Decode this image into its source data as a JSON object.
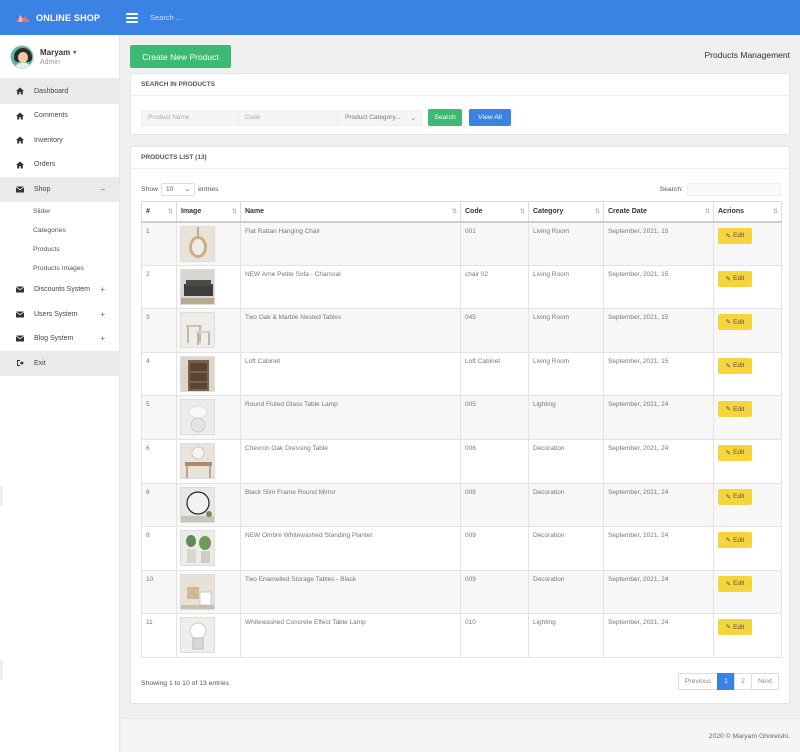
{
  "brand": {
    "name": "ONLINE SHOP",
    "accent": "#3a82e4"
  },
  "topbar": {
    "search_placeholder": "Search ..."
  },
  "user": {
    "name": "Maryam",
    "role": "Admin"
  },
  "sidebar": {
    "items": [
      {
        "label": "Dashboard",
        "icon": "home-icon"
      },
      {
        "label": "Comments",
        "icon": "home-icon"
      },
      {
        "label": "Inventory",
        "icon": "home-icon"
      },
      {
        "label": "Orders",
        "icon": "home-icon"
      },
      {
        "label": "Shop",
        "icon": "envelope-icon",
        "toggle": "−"
      },
      {
        "label": "Discounts System",
        "icon": "envelope-icon",
        "toggle": "+"
      },
      {
        "label": "Users System",
        "icon": "envelope-icon",
        "toggle": "+"
      },
      {
        "label": "Blog System",
        "icon": "envelope-icon",
        "toggle": "+"
      },
      {
        "label": "Exit",
        "icon": "sign-out-icon"
      }
    ],
    "shop_sub": [
      "Slider",
      "Categories",
      "Products",
      "Products Images"
    ]
  },
  "main": {
    "create_button": "Create New Product",
    "page_title": "Products Management"
  },
  "search_panel": {
    "title": "SEARCH IN PRODUCTS",
    "name_placeholder": "Product Name",
    "code_placeholder": "Code",
    "category_select": "Product Category...",
    "search_button": "Search",
    "view_all_button": "View All"
  },
  "list_panel": {
    "title": "PRODUCTS LIST (13)",
    "show_label": "Show",
    "entries_value": "10",
    "entries_label": "entries",
    "search_label": "Search:",
    "columns": [
      "#",
      "Image",
      "Name",
      "Code",
      "Category",
      "Create Date",
      "Acrions"
    ],
    "rows": [
      {
        "n": "1",
        "name": "Flat Rattan Hanging Chair",
        "code": "001",
        "category": "Living Room",
        "date": "September, 2021, 15"
      },
      {
        "n": "2",
        "name": "NEW Arne Petite Sofa - Charcoal",
        "code": "chair 02",
        "category": "Living Room",
        "date": "September, 2021, 15"
      },
      {
        "n": "3",
        "name": "Two Oak & Marble Nested Tables",
        "code": "045",
        "category": "Living Room",
        "date": "September, 2021, 15"
      },
      {
        "n": "4",
        "name": "Loft Cabinet",
        "code": "Loft Cabinet",
        "category": "Living Room",
        "date": "September, 2021, 15"
      },
      {
        "n": "5",
        "name": "Round Fluted Glass Table Lamp",
        "code": "005",
        "category": "Lighting",
        "date": "September, 2021, 24"
      },
      {
        "n": "6",
        "name": "Chevron Oak Dressing Table",
        "code": "006",
        "category": "Decoration",
        "date": "September, 2021, 24"
      },
      {
        "n": "8",
        "name": "Black Slim Frame Round Mirror",
        "code": "008",
        "category": "Decoration",
        "date": "September, 2021, 24"
      },
      {
        "n": "9",
        "name": "NEW Ombre Whitewashed Standing Planter",
        "code": "009",
        "category": "Decoration",
        "date": "September, 2021, 24"
      },
      {
        "n": "10",
        "name": "Two Enamelled Storage Tables - Black",
        "code": "009",
        "category": "Decoration",
        "date": "September, 2021, 24"
      },
      {
        "n": "11",
        "name": "Whitewashed Concrete Effect Table Lamp",
        "code": "010",
        "category": "Lighting",
        "date": "September, 2021, 24"
      }
    ],
    "edit_label": "Edit",
    "info": "Showing 1 to 10 of 13 entries",
    "pagination": {
      "previous": "Previous",
      "pages": [
        "1",
        "2"
      ],
      "current": "1",
      "next": "Next"
    }
  },
  "footer": {
    "text": "2020 © Maryam Ghoreishi."
  }
}
